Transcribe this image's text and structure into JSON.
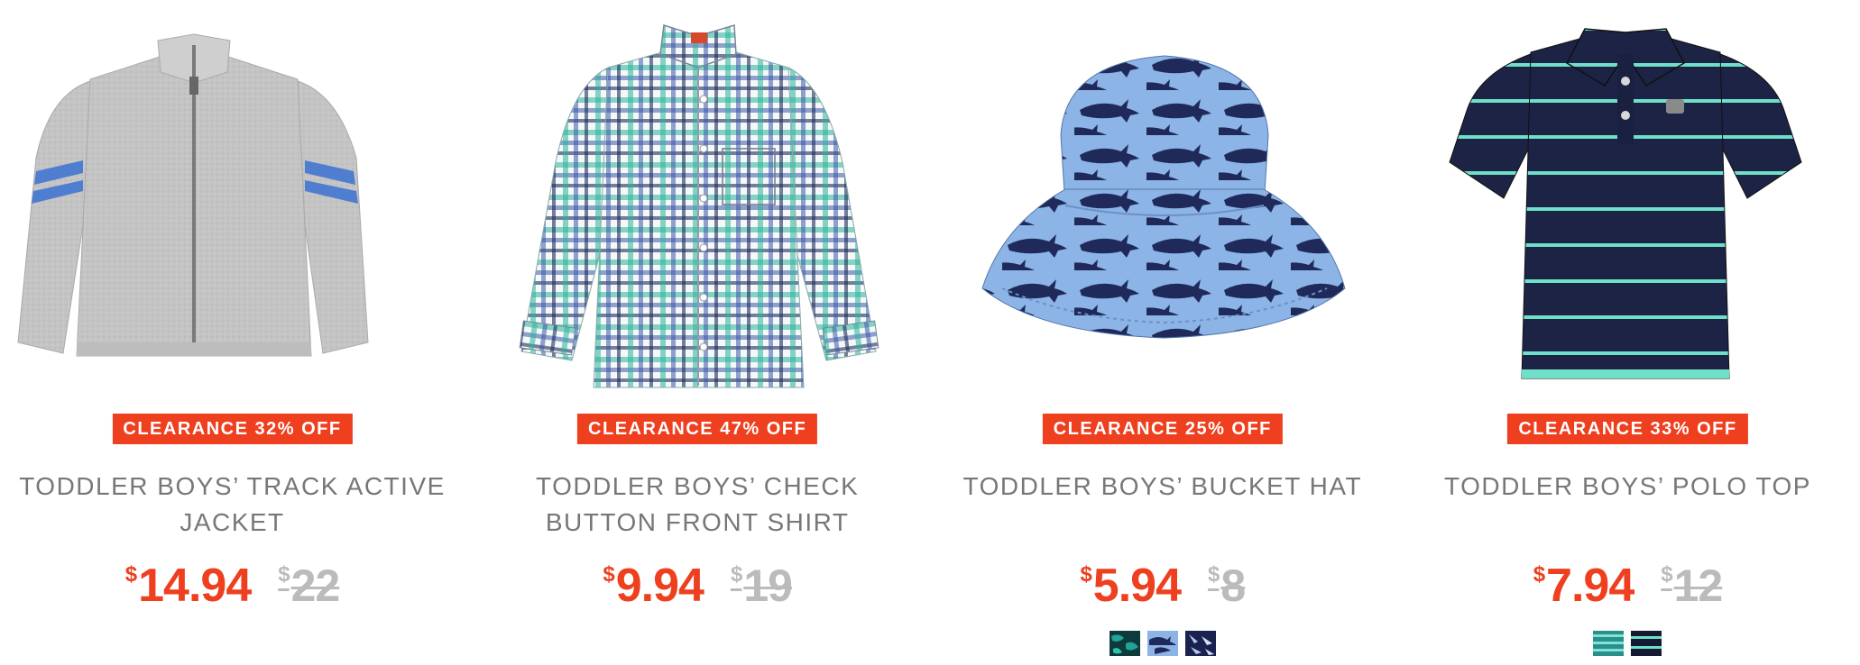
{
  "products": [
    {
      "badge": "CLEARANCE 32% OFF",
      "title": "TODDLER BOYS’ TRACK ACTIVE JACKET",
      "currency": "$",
      "sale_price": "14.94",
      "original_price": "22",
      "image_icon": "gray-track-jacket-image",
      "swatches": []
    },
    {
      "badge": "CLEARANCE 47% OFF",
      "title": "TODDLER BOYS’ CHECK BUTTON FRONT SHIRT",
      "currency": "$",
      "sale_price": "9.94",
      "original_price": "19",
      "image_icon": "plaid-shirt-image",
      "swatches": []
    },
    {
      "badge": "CLEARANCE 25% OFF",
      "title": "TODDLER BOYS’ BUCKET HAT",
      "currency": "$",
      "sale_price": "5.94",
      "original_price": "8",
      "image_icon": "shark-bucket-hat-image",
      "swatches": [
        "teal-camo-swatch",
        "blue-shark-swatch",
        "navy-pattern-swatch"
      ]
    },
    {
      "badge": "CLEARANCE 33% OFF",
      "title": "TODDLER BOYS’ POLO TOP",
      "currency": "$",
      "sale_price": "7.94",
      "original_price": "12",
      "image_icon": "striped-polo-image",
      "swatches": [
        "teal-stripe-swatch",
        "navy-stripe-swatch"
      ]
    }
  ],
  "colors": {
    "badge_bg": "#ee3f1f",
    "sale_price": "#ee3f1f",
    "original_price": "#bbbbbb",
    "title": "#777777"
  }
}
